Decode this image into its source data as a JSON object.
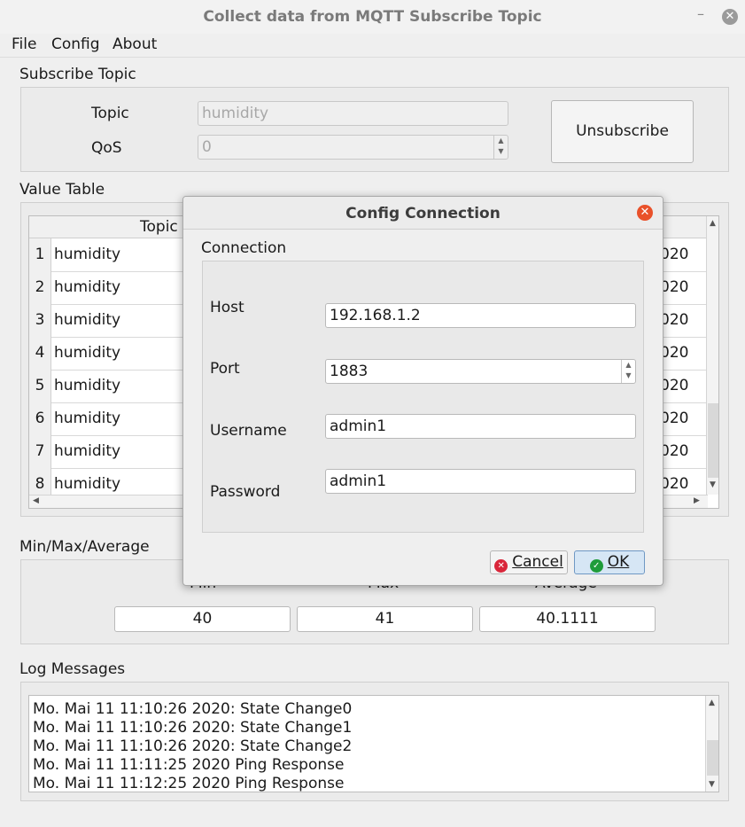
{
  "window": {
    "title": "Collect data from MQTT Subscribe Topic",
    "minimize_glyph": "–",
    "close_glyph": "✕"
  },
  "menu": [
    "File",
    "Config",
    "About"
  ],
  "subscribe": {
    "group_label": "Subscribe Topic",
    "topic_label": "Topic",
    "topic_value": "humidity",
    "qos_label": "QoS",
    "qos_value": "0",
    "unsubscribe_label": "Unsubscribe"
  },
  "value_table": {
    "group_label": "Value Table",
    "header_topic": "Topic",
    "rows": [
      {
        "num": "1",
        "topic": "humidity",
        "date_tail": "020"
      },
      {
        "num": "2",
        "topic": "humidity",
        "date_tail": "020"
      },
      {
        "num": "3",
        "topic": "humidity",
        "date_tail": "020"
      },
      {
        "num": "4",
        "topic": "humidity",
        "date_tail": "020"
      },
      {
        "num": "5",
        "topic": "humidity",
        "date_tail": "020"
      },
      {
        "num": "6",
        "topic": "humidity",
        "date_tail": "020"
      },
      {
        "num": "7",
        "topic": "humidity",
        "date_tail": "020"
      },
      {
        "num": "8",
        "topic": "humidity",
        "date_tail": "020"
      }
    ]
  },
  "stats": {
    "group_label": "Min/Max/Average",
    "min_label": "Min",
    "max_label": "Max",
    "avg_label": "Average",
    "min_value": "40",
    "max_value": "41",
    "avg_value": "40.1111"
  },
  "log": {
    "group_label": "Log Messages",
    "lines": [
      "Mo. Mai 11 11:10:26 2020: State Change0",
      "Mo. Mai 11 11:10:26 2020: State Change1",
      "Mo. Mai 11 11:10:26 2020: State Change2",
      "Mo. Mai 11 11:11:25 2020 Ping Response",
      "Mo. Mai 11 11:12:25 2020 Ping Response"
    ]
  },
  "dialog": {
    "title": "Config Connection",
    "close_glyph": "✕",
    "group_label": "Connection",
    "host_label": "Host",
    "host_value": "192.168.1.2",
    "port_label": "Port",
    "port_value": "1883",
    "username_label": "Username",
    "username_value": "admin1",
    "password_label": "Password",
    "password_value": "admin1",
    "cancel_label": "Cancel",
    "ok_label": "OK",
    "cancel_icon": "✕",
    "ok_icon": "✓"
  },
  "colors": {
    "dialog_close": "#e9512a",
    "cancel_icon": "#d9263a",
    "ok_icon": "#1e9c3a",
    "ok_button_bg": "#d6e6f5"
  }
}
